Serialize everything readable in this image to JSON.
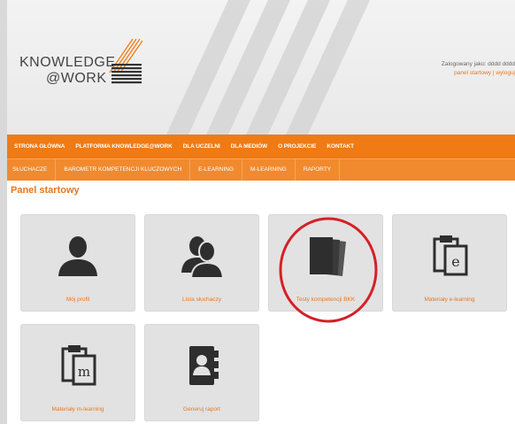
{
  "logo": {
    "line1": "KNOWLEDGE",
    "line2": "@WORK"
  },
  "user": {
    "logged_in_as": "Zalogowany jako: dddd dddd",
    "links": "panel startowy | wyloguj"
  },
  "main_nav": [
    "STRONA GŁÓWNA",
    "PLATFORMA KNOWLEDGE@WORK",
    "DLA UCZELNI",
    "DLA MEDIÓW",
    "O PROJEKCIE",
    "KONTAKT"
  ],
  "sub_nav": [
    "SŁUCHACZE",
    "BAROMETR KOMPETENCJI KLUCZOWYCH",
    "E-LEARNING",
    "M-LEARNING",
    "RAPORTY"
  ],
  "panel_title": "Panel startowy",
  "tiles": [
    {
      "label": "Mój profil",
      "icon": "user-icon"
    },
    {
      "label": "Lista słuchaczy",
      "icon": "users-icon"
    },
    {
      "label": "Testy kompetencji BKK",
      "icon": "documents-stack-icon"
    },
    {
      "label": "Materiały e-learning",
      "icon": "clipboard-e-icon"
    },
    {
      "label": "Materiały m-learning",
      "icon": "clipboard-m-icon"
    },
    {
      "label": "Generuj raport",
      "icon": "contact-book-icon"
    }
  ],
  "colors": {
    "accent": "#f07a13",
    "tile_bg": "#e2e2e2",
    "icon": "#2e2e2e",
    "highlight_ring": "#d61f26"
  }
}
